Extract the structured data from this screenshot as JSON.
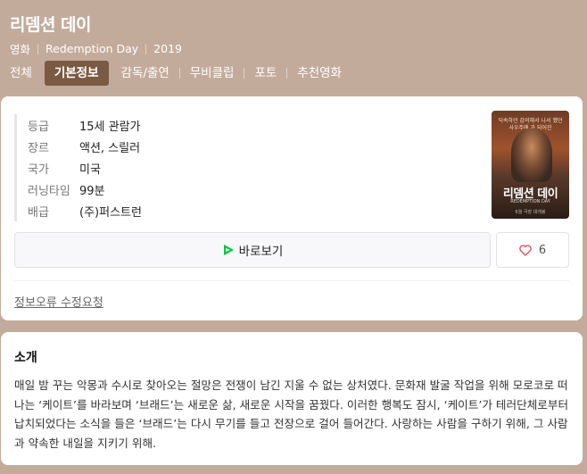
{
  "header": {
    "title": "리뎀션 데이",
    "meta": [
      "영화",
      "Redemption Day",
      "2019"
    ]
  },
  "tabs": [
    {
      "label": "전체",
      "active": false
    },
    {
      "label": "기본정보",
      "active": true
    },
    {
      "label": "감독/출연",
      "active": false
    },
    {
      "label": "무비클립",
      "active": false
    },
    {
      "label": "포토",
      "active": false
    },
    {
      "label": "추천영화",
      "active": false
    }
  ],
  "info": {
    "rows": [
      {
        "key": "등급",
        "value": "15세 관람가"
      },
      {
        "key": "장르",
        "value": "액션, 스릴러"
      },
      {
        "key": "국가",
        "value": "미국"
      },
      {
        "key": "러닝타임",
        "value": "99분"
      },
      {
        "key": "배급",
        "value": "(주)퍼스트런"
      }
    ],
    "poster": {
      "tagline": "딕속하던 감의해서 나서 했던 사우주에 가 되어진",
      "title": "리뎀션 데이",
      "subtitle": "REDEMPTION DAY",
      "date": "6월 극장 대개봉"
    },
    "watch_label": "바로보기",
    "like_count": "6",
    "report_label": "정보오류 수정요청"
  },
  "intro": {
    "title": "소개",
    "text": "매일 밤 꾸는 악몽과 수시로 찾아오는 절망은 전쟁이 남긴 지울 수 없는 상처였다. 문화재 발굴 작업을 위해 모로코로 떠나는 ‘케이트’를 바라보며 ‘브래드’는 새로운 삶, 새로운 시작을 꿈꿨다. 이러한 행복도 잠시, ‘케이트’가 테러단체로부터 납치되었다는 소식을 들은 ‘브래드’는 다시 무기를 들고 전장으로 걸어 들어간다. 사랑하는 사람을 구하기 위해, 그 사람과 약속한 내일을 지키기 위해."
  },
  "colors": {
    "background": "#c3ab9b",
    "active_tab": "#7a5a43",
    "heart": "#e0505a",
    "play": "#00c73c"
  }
}
